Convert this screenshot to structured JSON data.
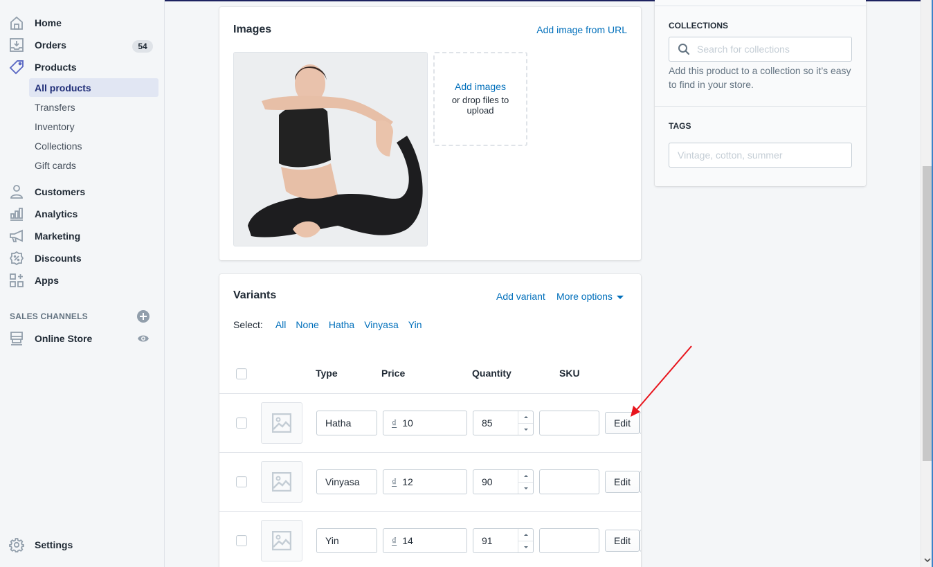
{
  "sidebar": {
    "items": [
      {
        "label": "Home",
        "icon": "home-icon"
      },
      {
        "label": "Orders",
        "icon": "orders-icon",
        "badge": "54"
      },
      {
        "label": "Products",
        "icon": "tag-icon"
      },
      {
        "label": "Customers",
        "icon": "person-icon"
      },
      {
        "label": "Analytics",
        "icon": "bar-chart-icon"
      },
      {
        "label": "Marketing",
        "icon": "megaphone-icon"
      },
      {
        "label": "Discounts",
        "icon": "discount-icon"
      },
      {
        "label": "Apps",
        "icon": "apps-icon"
      }
    ],
    "products_subitems": [
      {
        "label": "All products",
        "active": true
      },
      {
        "label": "Transfers"
      },
      {
        "label": "Inventory"
      },
      {
        "label": "Collections"
      },
      {
        "label": "Gift cards"
      }
    ],
    "sales_channels_title": "SALES CHANNELS",
    "online_store": "Online Store",
    "settings": "Settings"
  },
  "images_card": {
    "title": "Images",
    "add_from_url": "Add image from URL",
    "dropzone_link": "Add images",
    "dropzone_text": "or drop files to upload",
    "image_alt": "Woman in black yoga outfit doing a seated yoga pose"
  },
  "variants_card": {
    "title": "Variants",
    "add_variant": "Add variant",
    "more_options": "More options",
    "select_label": "Select:",
    "select_options": [
      "All",
      "None",
      "Hatha",
      "Vinyasa",
      "Yin"
    ],
    "columns": [
      "Type",
      "Price",
      "Quantity",
      "SKU"
    ],
    "currency_symbol": "₫",
    "edit_label": "Edit",
    "rows": [
      {
        "type": "Hatha",
        "price": "10",
        "quantity": "85",
        "sku": ""
      },
      {
        "type": "Vinyasa",
        "price": "12",
        "quantity": "90",
        "sku": ""
      },
      {
        "type": "Yin",
        "price": "14",
        "quantity": "91",
        "sku": ""
      }
    ]
  },
  "organization": {
    "collections_title": "COLLECTIONS",
    "collections_placeholder": "Search for collections",
    "collections_help": "Add this product to a collection so it’s easy to find in your store.",
    "tags_title": "TAGS",
    "tags_placeholder": "Vintage, cotton, summer"
  },
  "annotation": {
    "type": "arrow",
    "color": "#e8141c",
    "target": "Edit button (Hatha row)"
  }
}
